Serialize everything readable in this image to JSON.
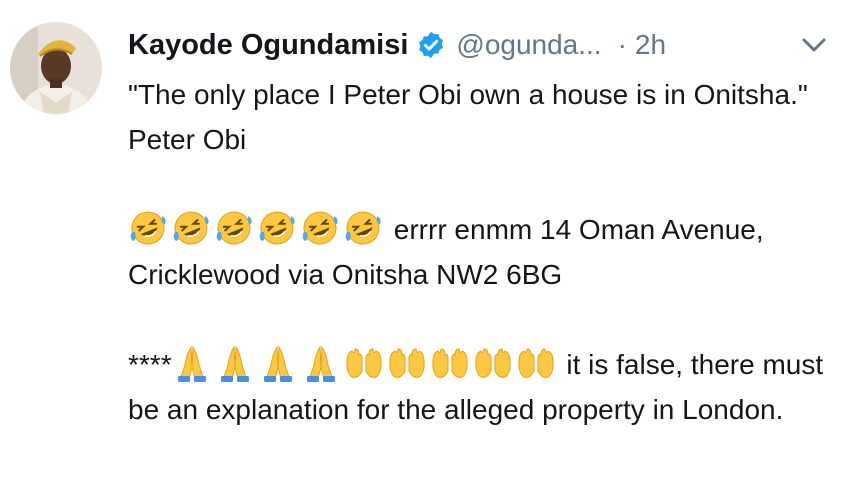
{
  "tweet": {
    "author": {
      "display_name": "Kayode Ogundamisi",
      "handle": "@ogunda...",
      "verified": true
    },
    "timestamp_separator": "·",
    "timestamp": "2h",
    "icons": {
      "verified": "verified-badge-icon",
      "menu": "chevron-down-icon",
      "laugh": "rolling-on-floor-laughing-emoji",
      "pray": "folded-hands-emoji",
      "open_hands": "open-hands-emoji"
    },
    "colors": {
      "verified_blue": "#1da1f2",
      "secondary_text": "#657786",
      "primary_text": "#14171a"
    },
    "lines": {
      "p1": "\"The only place I Peter Obi own a house is in Onitsha.\" Peter Obi",
      "p2_text": " errrr enmm 14 Oman Avenue, Cricklewood via Onitsha NW2 6BG",
      "p3_prefix": "****",
      "p3_text": " it is false, there must be an explanation for the alleged property in London."
    },
    "emoji_counts": {
      "laugh": 6,
      "pray": 4,
      "open_hands": 5
    }
  }
}
